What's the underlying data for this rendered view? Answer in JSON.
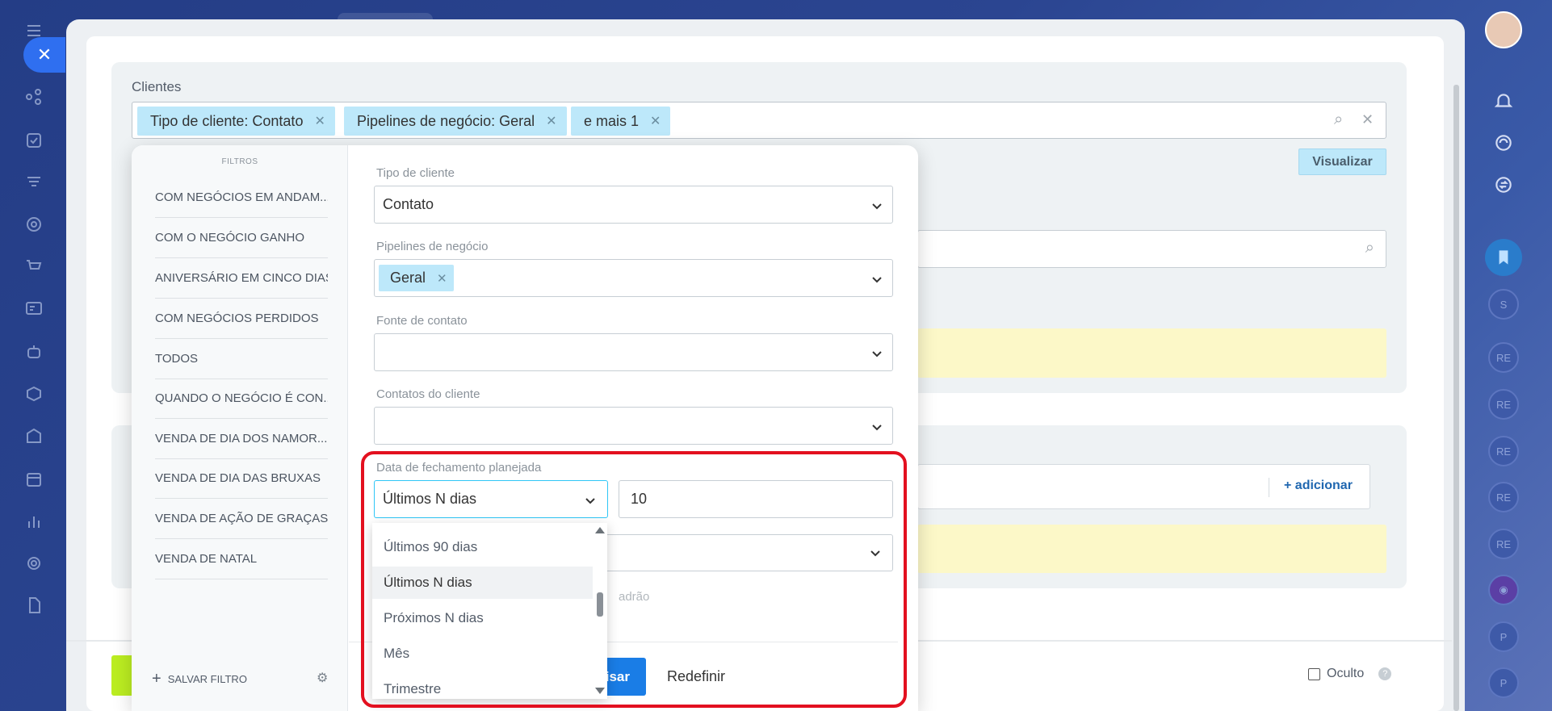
{
  "filter_title": "Clientes",
  "chips": [
    {
      "label": "Tipo de cliente: Contato"
    },
    {
      "label": "Pipelines de negócio: Geral"
    },
    {
      "label": "e mais 1"
    }
  ],
  "visualizar_label": "Visualizar",
  "adicionar_label": "+ adicionar",
  "oculto_label": "Oculto",
  "presets_title": "FILTROS",
  "presets": [
    "COM NEGÓCIOS EM ANDAM...",
    "COM O NEGÓCIO GANHO",
    "ANIVERSÁRIO EM CINCO DIAS",
    "COM NEGÓCIOS PERDIDOS",
    "TODOS",
    "QUANDO O NEGÓCIO É CON...",
    "VENDA DE DIA DOS NAMOR...",
    "VENDA DE DIA DAS BRUXAS",
    "VENDA DE AÇÃO DE GRAÇAS",
    "VENDA DE NATAL"
  ],
  "save_filter_label": "SALVAR FILTRO",
  "fields": {
    "tipo_label": "Tipo de cliente",
    "tipo_value": "Contato",
    "pipelines_label": "Pipelines de negócio",
    "pipelines_chip": "Geral",
    "fonte_label": "Fonte de contato",
    "contatos_label": "Contatos do cliente",
    "data_label": "Data de fechamento planejada",
    "data_period": "Últimos N dias",
    "data_days": "10"
  },
  "dropdown_options": [
    "Últimos 90 dias",
    "Últimos N dias",
    "Próximos N dias",
    "Mês",
    "Trimestre"
  ],
  "dropdown_selected": "Últimos N dias",
  "padrao_text": "adrão",
  "search_button_label": "isar",
  "reset_label": "Redefinir",
  "colors": {
    "highlight": "#e3101f",
    "chip": "#bde8fa",
    "primary": "#1a7de6"
  }
}
